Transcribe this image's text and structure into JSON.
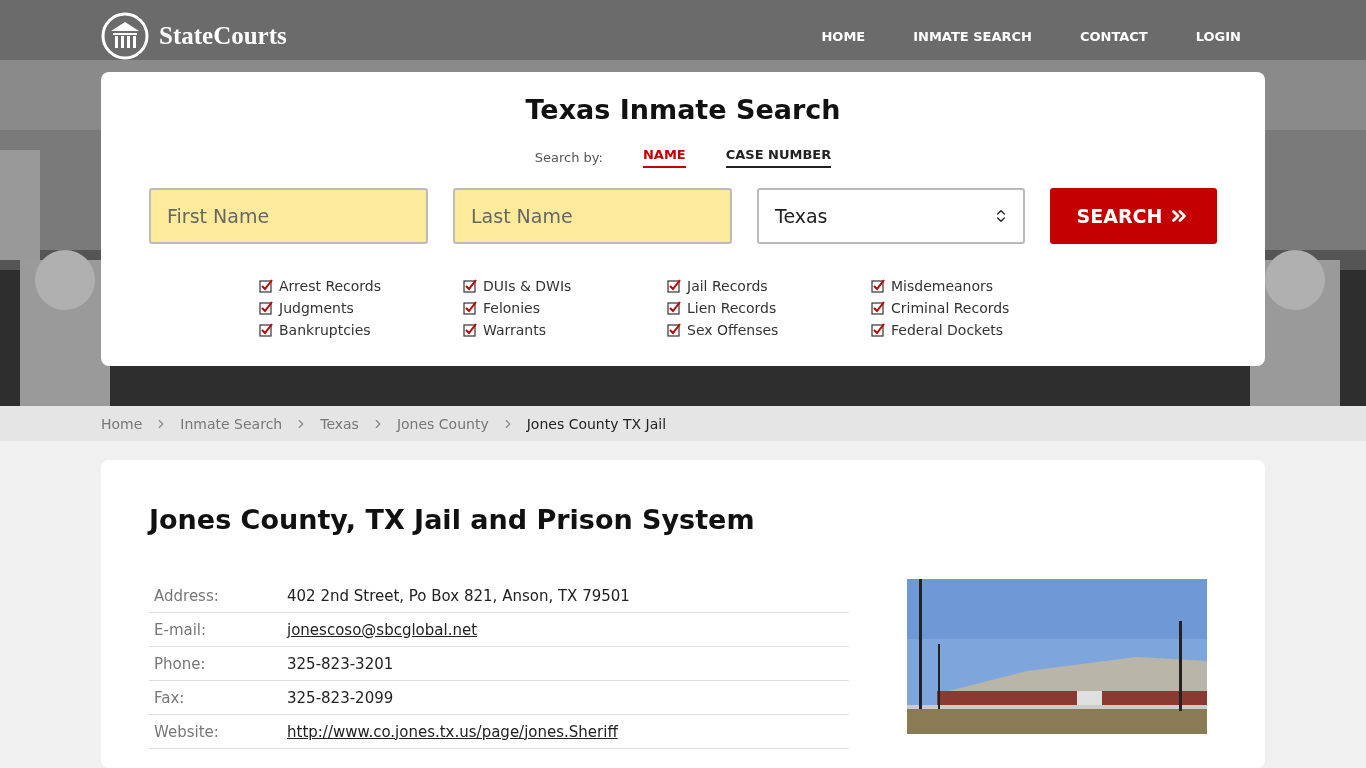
{
  "header": {
    "logo": "StateCourts",
    "nav": [
      "HOME",
      "INMATE SEARCH",
      "CONTACT",
      "LOGIN"
    ]
  },
  "search": {
    "title": "Texas Inmate Search",
    "search_by": "Search by:",
    "tabs": [
      {
        "label": "NAME",
        "selected": true
      },
      {
        "label": "CASE NUMBER",
        "selected": false
      }
    ],
    "first_name": {
      "placeholder": "First Name"
    },
    "last_name": {
      "placeholder": "Last Name"
    },
    "state": {
      "value": "Texas"
    },
    "button": "SEARCH",
    "options": [
      {
        "label": "Arrest Records",
        "checked": true
      },
      {
        "label": "DUIs & DWIs",
        "checked": true
      },
      {
        "label": "Jail Records",
        "checked": true
      },
      {
        "label": "Misdemeanors",
        "checked": true
      },
      {
        "label": "Judgments",
        "checked": true
      },
      {
        "label": "Felonies",
        "checked": true
      },
      {
        "label": "Lien Records",
        "checked": true
      },
      {
        "label": "Criminal Records",
        "checked": true
      },
      {
        "label": "Bankruptcies",
        "checked": true
      },
      {
        "label": "Warrants",
        "checked": true
      },
      {
        "label": "Sex Offenses",
        "checked": true
      },
      {
        "label": "Federal Dockets",
        "checked": true
      }
    ]
  },
  "breadcrumbs": [
    "Home",
    "Inmate Search",
    "Texas",
    "Jones County",
    "Jones County TX Jail"
  ],
  "content": {
    "title": "Jones County, TX Jail and Prison System",
    "details": [
      {
        "label": "Address:",
        "value": "402 2nd Street, Po Box 821, Anson, TX 79501",
        "kind": "text"
      },
      {
        "label": "E-mail:",
        "value": "jonescoso@sbcglobal.net",
        "kind": "link"
      },
      {
        "label": "Phone:",
        "value": "325-823-3201",
        "kind": "text"
      },
      {
        "label": "Fax:",
        "value": "325-823-2099",
        "kind": "text"
      },
      {
        "label": "Website:",
        "value": "http://www.co.jones.tx.us/page/jones.Sheriff",
        "kind": "link"
      }
    ]
  }
}
